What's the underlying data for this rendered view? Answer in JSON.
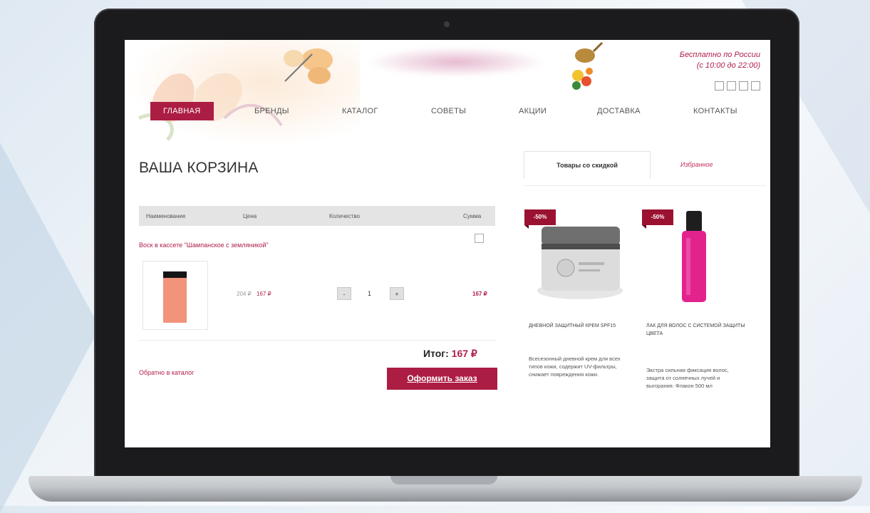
{
  "header": {
    "info_line1": "Бесплатно по России",
    "info_line2": "(с 10:00 до 22:00)",
    "social_icons": [
      "social-icon-1",
      "social-icon-2",
      "social-icon-3",
      "social-icon-4"
    ]
  },
  "nav": {
    "items": [
      "ГЛАВНАЯ",
      "БРЕНДЫ",
      "КАТАЛОГ",
      "СОВЕТЫ",
      "АКЦИИ",
      "ДОСТАВКА",
      "КОНТАКТЫ"
    ],
    "active_index": 0
  },
  "cart": {
    "title": "ВАША КОРЗИНА",
    "columns": [
      "Наименование",
      "Цена",
      "Количество",
      "Сумма"
    ],
    "item": {
      "name": "Воск в кассете \"Шампанское с земляникой\"",
      "old_price": "204 ₽",
      "price": "167 ₽",
      "qty": "1",
      "minus": "-",
      "plus": "+",
      "sum": "167 ₽"
    },
    "total_label": "Итог:",
    "total_value": "167 ₽",
    "back_link": "Обратно в каталог",
    "order_button": "Оформить заказ"
  },
  "sidebar": {
    "tabs": [
      "Товары со скидкой",
      "Избранное"
    ],
    "products": [
      {
        "badge": "-50%",
        "title": "ДНЕВНОЙ ЗАЩИТНЫЙ КРЕМ SPF15",
        "desc": "Всесезонный дневной крем для всех типов кожи, содержит UV-фильтры, снижает повреждения кожи."
      },
      {
        "badge": "-50%",
        "title": "ЛАК ДЛЯ ВОЛОС С СИСТЕМОЙ ЗАЩИТЫ ЦВЕТА",
        "desc": "Экстра сильная фиксация волос, защита от солнечных лучей и выгорания. Флакон 500 мл"
      }
    ]
  },
  "colors": {
    "accent": "#ac1d43",
    "accent_text": "#b01e48",
    "badge": "#9b1231"
  }
}
